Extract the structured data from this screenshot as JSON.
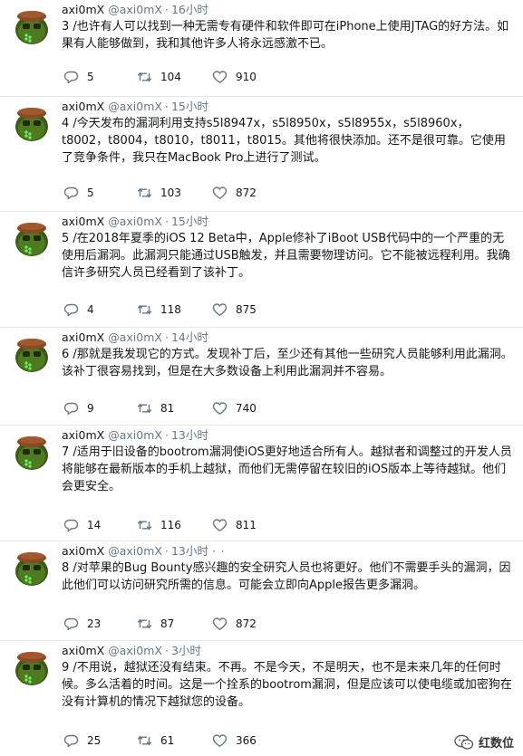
{
  "tweets": [
    {
      "name": "axi0mX",
      "handle": "@axi0mX",
      "time": "16小时",
      "text": "3 /也许有人可以找到一种无需专有硬件和软件即可在iPhone上使用JTAG的好方法。如果有人能够做到，我和其他许多人将永远感激不已。",
      "replies": "5",
      "retweets": "104",
      "likes": "910",
      "more": ""
    },
    {
      "name": "axi0mX",
      "handle": "@axi0mX",
      "time": "15小时",
      "text": "4 /今天发布的漏洞利用支持s5l8947x，s5l8950x，s5l8955x，s5l8960x，t8002，t8004，t8010，t8011，t8015。其他将很快添加。还不是很可靠。它使用了竞争条件，我只在MacBook Pro上进行了测试。",
      "replies": "5",
      "retweets": "103",
      "likes": "872",
      "more": ""
    },
    {
      "name": "axi0mX",
      "handle": "@axi0mX",
      "time": "15小时",
      "text": "5 /在2018年夏季的iOS 12 Beta中，Apple修补了iBoot USB代码中的一个严重的无使用后漏洞。此漏洞只能通过USB触发，并且需要物理访问。它不能被远程利用。我确信许多研究人员已经看到了该补丁。",
      "replies": "4",
      "retweets": "118",
      "likes": "875",
      "more": ""
    },
    {
      "name": "axi0mX",
      "handle": "@axi0mX",
      "time": "14小时",
      "text": "6 /那就是我发现它的方式。发现补丁后，至少还有其他一些研究人员能够利用此漏洞。该补丁很容易找到，但是在大多数设备上利用此漏洞并不容易。",
      "replies": "9",
      "retweets": "81",
      "likes": "740",
      "more": ""
    },
    {
      "name": "axi0mX",
      "handle": "@axi0mX",
      "time": "13小时",
      "text": "7 /适用于旧设备的bootrom漏洞使iOS更好地适合所有人。越狱者和调整过的开发人员将能够在最新版本的手机上越狱，而他们无需停留在较旧的iOS版本上等待越狱。他们会更安全。",
      "replies": "14",
      "retweets": "116",
      "likes": "811",
      "more": ""
    },
    {
      "name": "axi0mX",
      "handle": "@axi0mX",
      "time": "13小时",
      "text": "8 /对苹果的Bug Bounty感兴趣的安全研究人员也将更好。他们不需要手头的漏洞，因此他们可以访问研究所需的信息。可能会立即向Apple报告更多漏洞。",
      "replies": "23",
      "retweets": "87",
      "likes": "872",
      "more": "· ·"
    },
    {
      "name": "axi0mX",
      "handle": "@axi0mX",
      "time": "3小时",
      "text": "9 /不用说，越狱还没有结束。不再。不是今天，不是明天，也不是未来几年的任何时候。多么活着的时间。这是一个拴系的bootrom漏洞，但是应该可以使电缆或加密狗在没有计算机的情况下越狱您的设备。",
      "replies": "25",
      "retweets": "61",
      "likes": "366",
      "more": ""
    }
  ],
  "watermark": {
    "label": "红数位"
  },
  "colors": {
    "muted": "#657786",
    "text": "#14171a",
    "divider": "#e6ecf0"
  },
  "icons": [
    "reply-icon",
    "retweet-icon",
    "like-icon"
  ]
}
